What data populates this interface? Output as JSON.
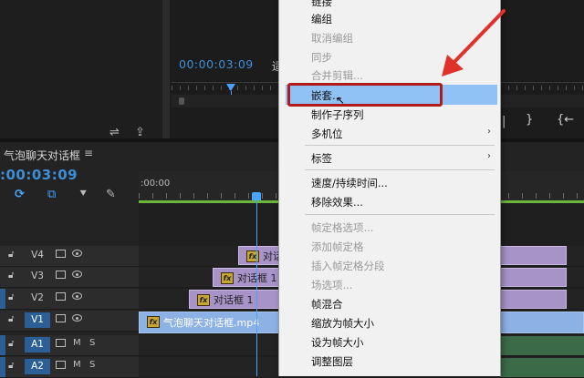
{
  "monitor": {
    "timecode": "00:00:03:09",
    "fit_label": "适",
    "controls": [
      "|",
      "}",
      "{←"
    ]
  },
  "timeline": {
    "sequence_name": "气泡聊天对话框",
    "menu_glyph": "≡",
    "current_time": ":00:03:09",
    "ruler_start": ":00:00"
  },
  "tracks": [
    {
      "id": "V4",
      "type": "video"
    },
    {
      "id": "V3",
      "type": "video"
    },
    {
      "id": "V2",
      "type": "video"
    },
    {
      "id": "V1",
      "type": "video"
    },
    {
      "id": "A1",
      "type": "audio",
      "m": "M",
      "s": "S"
    },
    {
      "id": "A2",
      "type": "audio",
      "m": "M",
      "s": "S"
    }
  ],
  "clips": {
    "v4": "对话",
    "v3": "对话框 1",
    "v2": "对话框 1",
    "v1": "气泡聊天对话框.mp4",
    "fx": "fx"
  },
  "context_menu": {
    "items": [
      {
        "label": "链接",
        "disabled": false
      },
      {
        "label": "编组",
        "disabled": false
      },
      {
        "label": "取消编组",
        "disabled": true
      },
      {
        "label": "同步",
        "disabled": true
      },
      {
        "label": "合并剪辑...",
        "disabled": true
      },
      {
        "label": "嵌套...",
        "disabled": false,
        "highlighted": true
      },
      {
        "label": "制作子序列",
        "disabled": false
      },
      {
        "label": "多机位",
        "disabled": false,
        "submenu": true
      },
      {
        "label": "标签",
        "disabled": false,
        "submenu": true
      },
      {
        "label": "速度/持续时间...",
        "disabled": false
      },
      {
        "label": "移除效果...",
        "disabled": false
      },
      {
        "label": "帧定格选项...",
        "disabled": true
      },
      {
        "label": "添加帧定格",
        "disabled": true
      },
      {
        "label": "插入帧定格分段",
        "disabled": true
      },
      {
        "label": "场选项...",
        "disabled": true
      },
      {
        "label": "帧混合",
        "disabled": false
      },
      {
        "label": "缩放为帧大小",
        "disabled": false
      },
      {
        "label": "设为帧大小",
        "disabled": false
      },
      {
        "label": "调整图层",
        "disabled": false
      }
    ],
    "submenu_glyph": "›"
  },
  "annotation_color": "#b11a1a",
  "highlight_color": "#91c2f5",
  "timecode_color": "#3f8fd8"
}
